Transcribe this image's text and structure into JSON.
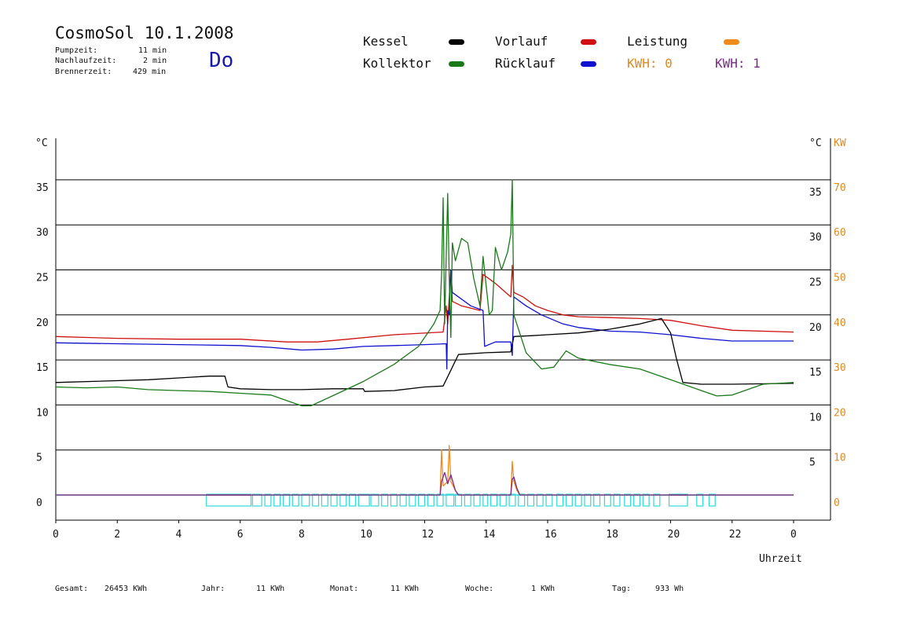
{
  "header": {
    "title": "CosmoSol 10.1.2008",
    "pumpzeit_label": "Pumpzeit:",
    "pumpzeit_value": "11 min",
    "nachlaufzeit_label": "Nachlaufzeit:",
    "nachlaufzeit_value": "2 min",
    "brennerzeit_label": "Brennerzeit:",
    "brennerzeit_value": "429 min",
    "weekday": "Do"
  },
  "legend": {
    "kessel": {
      "label": "Kessel",
      "color": "#000000"
    },
    "kollektor": {
      "label": "Kollektor",
      "color": "#1a7a1a"
    },
    "vorlauf": {
      "label": "Vorlauf",
      "color": "#d01010"
    },
    "ruecklauf": {
      "label": "Rücklauf",
      "color": "#1010d0"
    },
    "leistung": {
      "label": "Leistung",
      "color": "#f08a1a"
    },
    "kwh0": "KWH: 0",
    "kwh1": "KWH: 1"
  },
  "footer": {
    "gesamt_label": "Gesamt:",
    "gesamt_value": "26453 KWh",
    "jahr_label": "Jahr:",
    "jahr_value": "11 KWh",
    "monat_label": "Monat:",
    "monat_value": "11 KWh",
    "woche_label": "Woche:",
    "woche_value": "1 KWh",
    "tag_label": "Tag:",
    "tag_value": "933 Wh"
  },
  "chart_data": {
    "type": "line",
    "xlabel": "Uhrzeit",
    "x_ticks": [
      "0",
      "2",
      "4",
      "6",
      "8",
      "10",
      "12",
      "14",
      "16",
      "18",
      "20",
      "22",
      "0"
    ],
    "y_unit_left": "°C",
    "y_unit_right": "°C",
    "y2_unit": "KW",
    "y_ticks": [
      0,
      5,
      10,
      15,
      20,
      25,
      30,
      35
    ],
    "y2_ticks": [
      0,
      10,
      20,
      30,
      40,
      50,
      60,
      70
    ],
    "ylim": [
      0,
      35
    ],
    "xlim": [
      0,
      24
    ],
    "grid": true,
    "series": [
      {
        "name": "Vorlauf",
        "color": "#d01010",
        "points": [
          [
            0,
            17.6
          ],
          [
            1,
            17.5
          ],
          [
            2,
            17.4
          ],
          [
            4,
            17.3
          ],
          [
            6,
            17.3
          ],
          [
            7.5,
            17.0
          ],
          [
            8.5,
            17.0
          ],
          [
            9.5,
            17.3
          ],
          [
            11,
            17.8
          ],
          [
            12.6,
            18.1
          ],
          [
            12.7,
            21.0
          ],
          [
            12.75,
            19.0
          ],
          [
            12.85,
            25.0
          ],
          [
            12.9,
            21.5
          ],
          [
            13.2,
            21.0
          ],
          [
            13.8,
            20.5
          ],
          [
            13.9,
            24.5
          ],
          [
            14.3,
            23.5
          ],
          [
            14.8,
            22.0
          ],
          [
            14.85,
            25.5
          ],
          [
            14.9,
            22.5
          ],
          [
            15.2,
            22.0
          ],
          [
            15.6,
            21.0
          ],
          [
            16,
            20.5
          ],
          [
            16.5,
            20.0
          ],
          [
            17,
            19.8
          ],
          [
            18,
            19.7
          ],
          [
            19,
            19.6
          ],
          [
            20,
            19.4
          ],
          [
            21,
            18.8
          ],
          [
            22,
            18.3
          ],
          [
            24,
            18.1
          ]
        ]
      },
      {
        "name": "Rücklauf",
        "color": "#1010d0",
        "points": [
          [
            0,
            16.9
          ],
          [
            2,
            16.8
          ],
          [
            4,
            16.7
          ],
          [
            6,
            16.6
          ],
          [
            7,
            16.4
          ],
          [
            8,
            16.1
          ],
          [
            9,
            16.2
          ],
          [
            10,
            16.5
          ],
          [
            11,
            16.6
          ],
          [
            12,
            16.7
          ],
          [
            12.7,
            16.8
          ],
          [
            12.72,
            14.0
          ],
          [
            12.75,
            20.5
          ],
          [
            12.8,
            20.0
          ],
          [
            12.85,
            25.0
          ],
          [
            12.9,
            22.5
          ],
          [
            13.5,
            21.0
          ],
          [
            13.9,
            20.5
          ],
          [
            13.95,
            16.5
          ],
          [
            14.3,
            17.0
          ],
          [
            14.8,
            17.0
          ],
          [
            14.85,
            15.5
          ],
          [
            14.9,
            22.0
          ],
          [
            15.3,
            21.0
          ],
          [
            15.8,
            20.0
          ],
          [
            16.5,
            19.0
          ],
          [
            17,
            18.6
          ],
          [
            18,
            18.2
          ],
          [
            19,
            18.1
          ],
          [
            20,
            17.8
          ],
          [
            21,
            17.4
          ],
          [
            22,
            17.1
          ],
          [
            24,
            17.1
          ]
        ]
      },
      {
        "name": "Kessel",
        "color": "#000000",
        "points": [
          [
            0,
            12.5
          ],
          [
            3,
            12.8
          ],
          [
            4,
            13.0
          ],
          [
            5,
            13.2
          ],
          [
            5.5,
            13.2
          ],
          [
            5.6,
            12.0
          ],
          [
            6,
            11.8
          ],
          [
            7,
            11.7
          ],
          [
            8,
            11.7
          ],
          [
            9,
            11.8
          ],
          [
            10,
            11.8
          ],
          [
            10.05,
            11.5
          ],
          [
            11,
            11.6
          ],
          [
            12,
            12.0
          ],
          [
            12.6,
            12.1
          ],
          [
            12.8,
            13.5
          ],
          [
            13.1,
            15.6
          ],
          [
            14,
            15.8
          ],
          [
            14.8,
            15.9
          ],
          [
            14.9,
            17.6
          ],
          [
            15.5,
            17.7
          ],
          [
            16,
            17.8
          ],
          [
            17,
            18.0
          ],
          [
            18,
            18.4
          ],
          [
            19,
            19.0
          ],
          [
            19.7,
            19.6
          ],
          [
            20.0,
            18.0
          ],
          [
            20.2,
            15.0
          ],
          [
            20.4,
            12.5
          ],
          [
            21,
            12.3
          ],
          [
            22,
            12.3
          ],
          [
            24,
            12.4
          ]
        ]
      },
      {
        "name": "Kollektor",
        "color": "#1a7a1a",
        "points": [
          [
            0,
            12.0
          ],
          [
            1,
            11.9
          ],
          [
            2,
            12.0
          ],
          [
            3,
            11.7
          ],
          [
            4,
            11.6
          ],
          [
            5,
            11.5
          ],
          [
            6,
            11.3
          ],
          [
            7,
            11.1
          ],
          [
            8,
            9.9
          ],
          [
            8.3,
            9.9
          ],
          [
            9,
            11.0
          ],
          [
            10,
            12.6
          ],
          [
            11,
            14.5
          ],
          [
            11.8,
            16.5
          ],
          [
            12.3,
            19.0
          ],
          [
            12.5,
            20.5
          ],
          [
            12.55,
            24.5
          ],
          [
            12.6,
            33.0
          ],
          [
            12.65,
            19.0
          ],
          [
            12.75,
            33.5
          ],
          [
            12.8,
            24.0
          ],
          [
            12.85,
            17.5
          ],
          [
            12.9,
            28.0
          ],
          [
            13.0,
            26.0
          ],
          [
            13.2,
            28.5
          ],
          [
            13.4,
            28.0
          ],
          [
            13.6,
            24.0
          ],
          [
            13.8,
            21.0
          ],
          [
            13.9,
            26.5
          ],
          [
            14.1,
            20.0
          ],
          [
            14.2,
            20.5
          ],
          [
            14.3,
            27.5
          ],
          [
            14.5,
            25.0
          ],
          [
            14.7,
            27.0
          ],
          [
            14.8,
            29.0
          ],
          [
            14.85,
            35.0
          ],
          [
            14.9,
            20.0
          ],
          [
            15.3,
            15.8
          ],
          [
            15.8,
            14.0
          ],
          [
            16.2,
            14.2
          ],
          [
            16.6,
            16.0
          ],
          [
            17,
            15.2
          ],
          [
            18,
            14.5
          ],
          [
            19,
            14.0
          ],
          [
            20,
            12.8
          ],
          [
            21,
            11.6
          ],
          [
            21.5,
            11.0
          ],
          [
            22,
            11.1
          ],
          [
            23,
            12.3
          ],
          [
            24,
            12.5
          ]
        ]
      },
      {
        "name": "Leistung",
        "color": "#f08a1a",
        "axis": "KW",
        "points": [
          [
            0,
            0
          ],
          [
            12.5,
            0
          ],
          [
            12.55,
            10.0
          ],
          [
            12.6,
            2.0
          ],
          [
            12.75,
            3.0
          ],
          [
            12.8,
            11.0
          ],
          [
            12.85,
            3.0
          ],
          [
            13.0,
            1.0
          ],
          [
            13.1,
            0
          ],
          [
            14.8,
            0
          ],
          [
            14.85,
            7.5
          ],
          [
            14.9,
            3.0
          ],
          [
            15.0,
            1.0
          ],
          [
            15.1,
            0
          ],
          [
            24,
            0
          ]
        ]
      },
      {
        "name": "KWH: 1",
        "color": "#7a2a8a",
        "axis": "KW",
        "points": [
          [
            0,
            0
          ],
          [
            12.5,
            0
          ],
          [
            12.55,
            3.0
          ],
          [
            12.65,
            5.0
          ],
          [
            12.75,
            2.5
          ],
          [
            12.85,
            4.5
          ],
          [
            13.0,
            1.0
          ],
          [
            13.1,
            0
          ],
          [
            14.8,
            0
          ],
          [
            14.85,
            3.5
          ],
          [
            14.9,
            4.0
          ],
          [
            15.0,
            1.5
          ],
          [
            15.1,
            0
          ],
          [
            24,
            0
          ]
        ]
      }
    ],
    "pump_bar": {
      "name": "Pumpe",
      "color": "#30d8d8",
      "blocks": [
        [
          4.9,
          6.35
        ],
        [
          6.4,
          6.7
        ],
        [
          6.8,
          7.0
        ],
        [
          7.1,
          7.3
        ],
        [
          7.4,
          7.6
        ],
        [
          7.7,
          7.9
        ],
        [
          8.0,
          8.25
        ],
        [
          8.35,
          8.55
        ],
        [
          8.65,
          8.85
        ],
        [
          8.95,
          9.15
        ],
        [
          9.25,
          9.45
        ],
        [
          9.55,
          9.75
        ],
        [
          9.85,
          10.2
        ],
        [
          10.25,
          10.5
        ],
        [
          10.6,
          10.8
        ],
        [
          10.9,
          11.1
        ],
        [
          11.2,
          11.4
        ],
        [
          11.5,
          11.7
        ],
        [
          11.8,
          12.0
        ],
        [
          12.1,
          12.3
        ],
        [
          12.4,
          12.6
        ],
        [
          12.7,
          12.95
        ],
        [
          13.0,
          13.2
        ],
        [
          13.3,
          13.5
        ],
        [
          13.6,
          13.8
        ],
        [
          13.9,
          14.05
        ],
        [
          14.15,
          14.35
        ],
        [
          14.45,
          14.65
        ],
        [
          14.75,
          14.95
        ],
        [
          15.05,
          15.25
        ],
        [
          15.35,
          15.55
        ],
        [
          15.65,
          15.85
        ],
        [
          15.95,
          16.15
        ],
        [
          16.3,
          16.5
        ],
        [
          16.6,
          16.8
        ],
        [
          16.9,
          17.1
        ],
        [
          17.2,
          17.4
        ],
        [
          17.5,
          17.7
        ],
        [
          17.85,
          18.05
        ],
        [
          18.15,
          18.35
        ],
        [
          18.5,
          18.7
        ],
        [
          18.8,
          19.0
        ],
        [
          19.1,
          19.3
        ],
        [
          19.45,
          19.65
        ],
        [
          19.95,
          20.55
        ],
        [
          20.85,
          21.05
        ],
        [
          21.25,
          21.45
        ]
      ],
      "burner_blocks": [
        [
          4.9,
          6.35
        ],
        [
          19.95,
          20.55
        ]
      ]
    }
  }
}
